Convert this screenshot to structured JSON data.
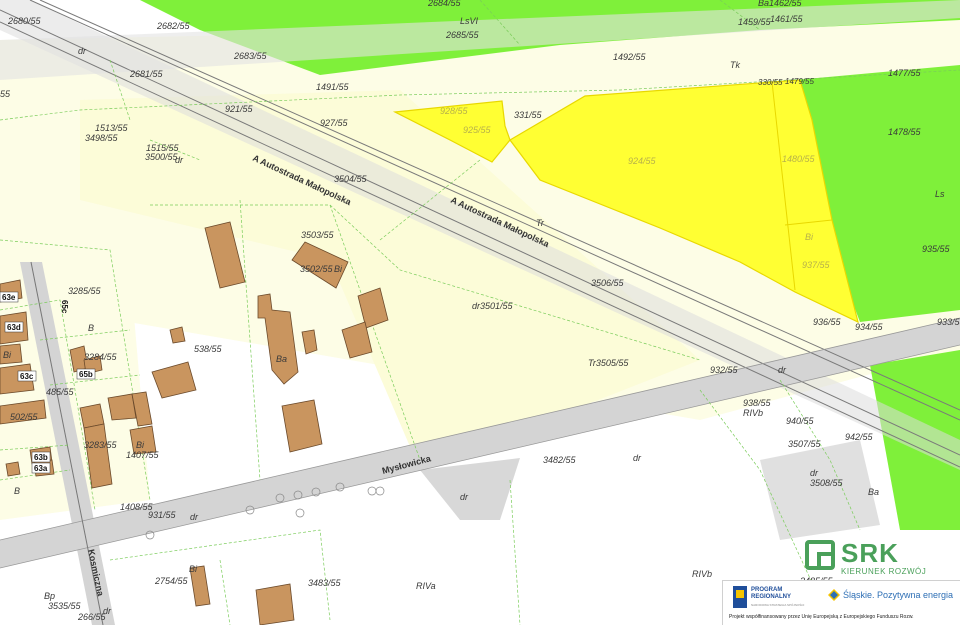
{
  "colors": {
    "forest_green": "#7ff03a",
    "yellow_area": "#ffff33",
    "road_gray": "#d8d8d8",
    "plot_border": "#7acc5a",
    "building": "#c9955f",
    "logo_green": "#4aa05a"
  },
  "streets": {
    "autostrada_1": "A Autostrada Małopolska",
    "autostrada_2": "A Autostrada Małopolska",
    "myslowicka": "Mysłowicka",
    "kosmiczna": "Kosmiczna"
  },
  "house_numbers": {
    "n63e": "63e",
    "n63d": "63d",
    "n63c": "63c",
    "n65b": "65b",
    "n63b": "63b",
    "n63a": "63a",
    "n65c": "65c"
  },
  "parcels": {
    "p2684": "2684/55",
    "pLsVI": "LsVI",
    "p2685": "2685/55",
    "p2680": "2680/55",
    "p2682": "2682/55",
    "pBa1462": "Ba1462/55",
    "p1459": "1459/55",
    "p1461": "1461/55",
    "pdr1": "dr",
    "p2683": "2683/55",
    "p1492": "1492/55",
    "pTk": "Tk",
    "p1477": "1477/55",
    "p2681": "2681/55",
    "p330": "330/55",
    "p1479": "1479/55",
    "p1491": "1491/55",
    "p55": "55",
    "p921": "921/55",
    "p928": "928/55",
    "p331": "331/55",
    "p927": "927/55",
    "p925": "925/55",
    "p1478": "1478/55",
    "p1513": "1513/55",
    "p3498": "3498/55",
    "p1515": "1515/55",
    "p3500": "3500/55",
    "pdr2": "dr",
    "p924": "924/55",
    "p1480": "1480/55",
    "p3504": "3504/55",
    "pLs": "Ls",
    "pTr": "Tr",
    "pBi1": "Bi",
    "p935": "935/55",
    "p3503": "3503/55",
    "p3502": "3502/55",
    "pBi2": "Bi",
    "p937": "937/55",
    "p3285": "3285/55",
    "p3506": "3506/55",
    "pdr3501": "dr3501/55",
    "p936": "936/55",
    "p934": "934/55",
    "p933": "933/55",
    "pB1": "B",
    "p538": "538/55",
    "p3284": "3284/55",
    "pBa": "Ba",
    "pTr3505": "Tr3505/55",
    "p932": "932/55",
    "pdr4": "dr",
    "p485": "485/55",
    "pBi3": "Bi",
    "p938": "938/55",
    "pRIVb1": "RIVb",
    "p502": "502/55",
    "p940": "940/55",
    "p3283": "3283/55",
    "p1407": "1407/55",
    "pBi4": "Bi",
    "p942": "942/55",
    "p3507": "3507/55",
    "p3482": "3482/55",
    "pdr5": "dr",
    "pdr6": "dr",
    "p3508": "3508/55",
    "pB2": "B",
    "pBa2": "Ba",
    "pdr7": "dr",
    "p1408": "1408/55",
    "p931": "931/55",
    "pdr8": "dr",
    "p2754": "2754/55",
    "pBi5": "Bi",
    "p3483": "3483/55",
    "pRIVb2": "RIVb",
    "p3485": "3485/55",
    "pBp": "Bp",
    "pRIVa": "RIVa",
    "p3535": "3535/55",
    "p266": "266/55",
    "pdr9": "dr"
  },
  "logo": {
    "name": "SRK",
    "sub": "KIERUNEK ROZWÓJ"
  },
  "footer": {
    "program_line1": "PROGRAM",
    "program_line2": "REGIONALNY",
    "program_sub": "NARODOWA STRATEGIA SPÓJNOŚCI",
    "slask": "Śląskie. Pozytywna energia",
    "funding": "Projekt współfinansowany przez Unię Europejską z Europejskiego Funduszu Rozw."
  }
}
